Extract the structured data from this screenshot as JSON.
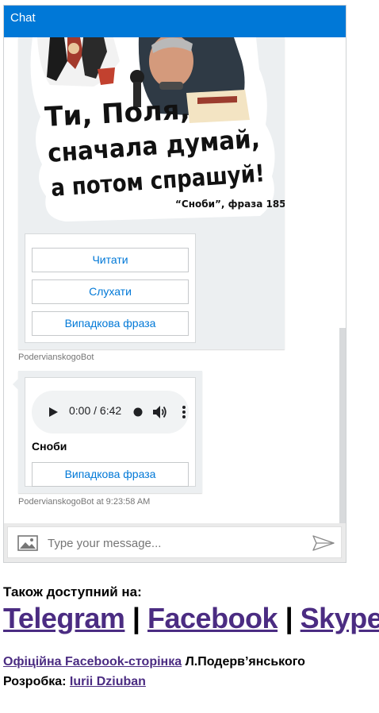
{
  "header": {
    "title": "Chat"
  },
  "card1": {
    "artwork": {
      "line1": "Ти, Поля,",
      "line2": "сначала думай,",
      "line3": "а потом спрашуй!",
      "caption": "“Сноби”, фраза 185"
    },
    "buttons": [
      "Читати",
      "Слухати",
      "Випадкова фраза"
    ],
    "sender": "PodervianskogoBot"
  },
  "card2": {
    "audio_time": "0:00 / 6:42",
    "title": "Сноби",
    "button": "Випадкова фраза",
    "meta": "PodervianskogoBot at 9:23:58 AM"
  },
  "input": {
    "placeholder": "Type your message..."
  },
  "footer": {
    "available_label": "Також доступний на:",
    "links": [
      "Telegram",
      "Facebook",
      "Skype"
    ],
    "separator": "|",
    "official_link": "Офіційна Facebook-сторінка",
    "official_suffix": " Л.Подерв’янського",
    "dev_label": "Розробка: ",
    "dev_link": "Iurii Dziuban"
  }
}
